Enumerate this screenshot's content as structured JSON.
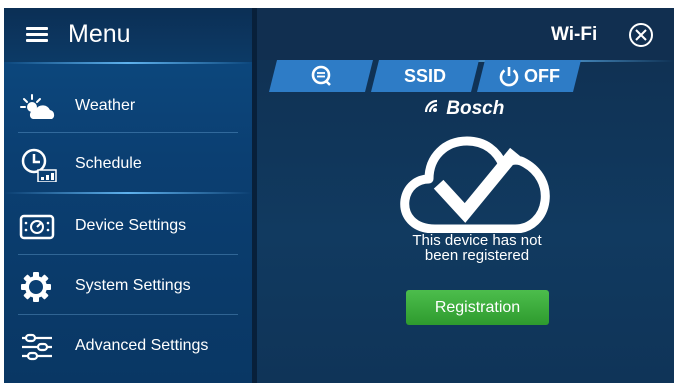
{
  "menu": {
    "title": "Menu",
    "items": [
      {
        "label": "Weather",
        "icon": "weather-icon"
      },
      {
        "label": "Schedule",
        "icon": "schedule-icon"
      },
      {
        "label": "Device Settings",
        "icon": "device-settings-icon"
      },
      {
        "label": "System Settings",
        "icon": "gear-icon"
      },
      {
        "label": "Advanced Settings",
        "icon": "sliders-icon"
      }
    ]
  },
  "header": {
    "title": "Wi-Fi",
    "close_icon": "close-circle-icon"
  },
  "tabs": {
    "search_icon": "search-icon",
    "ssid_label": "SSID",
    "power_label": "OFF",
    "power_icon": "power-icon"
  },
  "brand": {
    "name": "Bosch",
    "icon": "wifi-signal-icon"
  },
  "status": {
    "icon": "cloud-check-icon",
    "line1": "This device has not",
    "line2": "been registered"
  },
  "registration_button": {
    "label": "Registration"
  },
  "colors": {
    "sidebar": "#0c4478",
    "main_bg": "#0f3354",
    "tab": "#2e7cc6",
    "button_green": "#3aab3a"
  }
}
